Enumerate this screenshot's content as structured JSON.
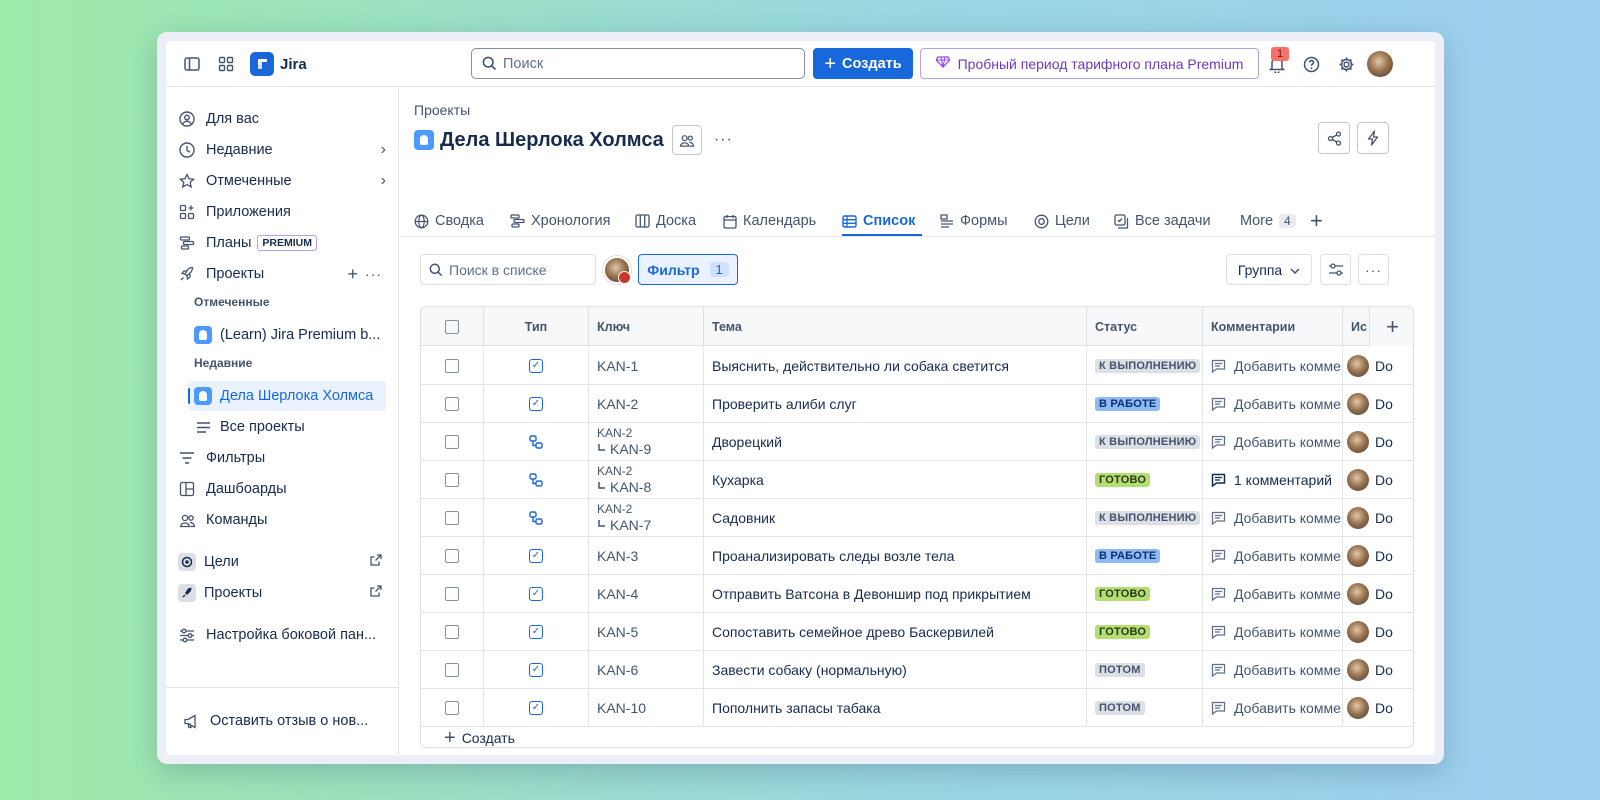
{
  "topbar": {
    "app_name": "Jira",
    "search_placeholder": "Поиск",
    "create_label": "Создать",
    "premium_trial_label": "Пробный период тарифного плана Premium",
    "notifications_count": "1"
  },
  "sidebar": {
    "for_you": "Для вас",
    "recent": "Недавние",
    "starred": "Отмеченные",
    "apps": "Приложения",
    "plans": "Планы",
    "plans_badge": "PREMIUM",
    "projects": "Проекты",
    "starred_section": "Отмеченные",
    "starred_project": "(Learn) Jira Premium b...",
    "recent_section": "Недавние",
    "recent_project": "Дела Шерлока Холмса",
    "all_projects": "Все проекты",
    "filters": "Фильтры",
    "dashboards": "Дашбоарды",
    "teams": "Команды",
    "goals": "Цели",
    "projects_ext": "Проекты",
    "sidebar_settings": "Настройка боковой пан...",
    "feedback": "Оставить отзыв о нов..."
  },
  "main": {
    "breadcrumb": "Проекты",
    "project_title": "Дела Шерлока Холмса",
    "tabs": [
      "Сводка",
      "Хронология",
      "Доска",
      "Календарь",
      "Список",
      "Формы",
      "Цели",
      "Все задачи"
    ],
    "more_label": "More",
    "more_count": "4",
    "list_search_placeholder": "Поиск в списке",
    "filter_label": "Фильтр",
    "filter_count": "1",
    "group_label": "Группа",
    "create_row_label": "Создать"
  },
  "table": {
    "columns": [
      "Тип",
      "Ключ",
      "Тема",
      "Статус",
      "Комментарии",
      "Ис"
    ],
    "rows": [
      {
        "type": "task",
        "parent": "",
        "key": "KAN-1",
        "summary": "Выяснить, действительно ли собака светится",
        "status": "К ВЫПОЛНЕНИЮ",
        "status_color": "#dcdfe4",
        "status_text_color": "#44546f",
        "comment": "Добавить комме",
        "assignee": "Do"
      },
      {
        "type": "task",
        "parent": "",
        "key": "KAN-2",
        "summary": "Проверить алиби слуг",
        "status": "В РАБОТЕ",
        "status_color": "#8fb8f6",
        "status_text_color": "#09326c",
        "comment": "Добавить комме",
        "assignee": "Do"
      },
      {
        "type": "subtask",
        "parent": "KAN-2",
        "key": "KAN-9",
        "summary": "Дворецкий",
        "status": "К ВЫПОЛНЕНИЮ",
        "status_color": "#dcdfe4",
        "status_text_color": "#44546f",
        "comment": "Добавить комме",
        "assignee": "Do"
      },
      {
        "type": "subtask",
        "parent": "KAN-2",
        "key": "KAN-8",
        "summary": "Кухарка",
        "status": "ГОТОВО",
        "status_color": "#b3df72",
        "status_text_color": "#2a3818",
        "comment": "1 комментарий",
        "assignee": "Do"
      },
      {
        "type": "subtask",
        "parent": "KAN-2",
        "key": "KAN-7",
        "summary": "Садовник",
        "status": "К ВЫПОЛНЕНИЮ",
        "status_color": "#dcdfe4",
        "status_text_color": "#44546f",
        "comment": "Добавить комме",
        "assignee": "Do"
      },
      {
        "type": "task",
        "parent": "",
        "key": "KAN-3",
        "summary": "Проанализировать следы возле тела",
        "status": "В РАБОТЕ",
        "status_color": "#8fb8f6",
        "status_text_color": "#09326c",
        "comment": "Добавить комме",
        "assignee": "Do"
      },
      {
        "type": "task",
        "parent": "",
        "key": "KAN-4",
        "summary": "Отправить Ватсона в Девоншир под прикрытием",
        "status": "ГОТОВО",
        "status_color": "#b3df72",
        "status_text_color": "#2a3818",
        "comment": "Добавить комме",
        "assignee": "Do"
      },
      {
        "type": "task",
        "parent": "",
        "key": "KAN-5",
        "summary": "Сопоставить семейное древо Баскервилей",
        "status": "ГОТОВО",
        "status_color": "#b3df72",
        "status_text_color": "#2a3818",
        "comment": "Добавить комме",
        "assignee": "Do"
      },
      {
        "type": "task",
        "parent": "",
        "key": "KAN-6",
        "summary": "Завести собаку (нормальную)",
        "status": "ПОТОМ",
        "status_color": "#dcdfe4",
        "status_text_color": "#44546f",
        "comment": "Добавить комме",
        "assignee": "Do"
      },
      {
        "type": "task",
        "parent": "",
        "key": "KAN-10",
        "summary": "Пополнить запасы табака",
        "status": "ПОТОМ",
        "status_color": "#dcdfe4",
        "status_text_color": "#44546f",
        "comment": "Добавить комме",
        "assignee": "Do"
      }
    ]
  }
}
